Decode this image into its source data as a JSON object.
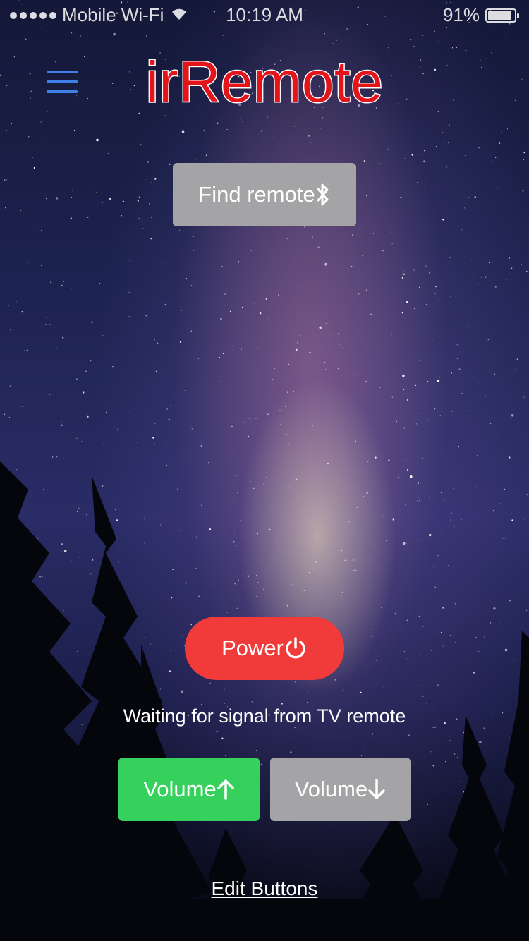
{
  "status_bar": {
    "carrier": "Mobile Wi-Fi",
    "time": "10:19 AM",
    "battery_text": "91%",
    "battery_level": 0.91
  },
  "header": {
    "menu_icon": "hamburger-menu-icon",
    "title": "irRemote",
    "title_color": "#e4141b",
    "menu_color": "#3f7fe8"
  },
  "find_remote": {
    "label": "Find remote",
    "icon": "bluetooth-icon",
    "color": "#a4a4a6"
  },
  "power": {
    "label": "Power",
    "icon": "power-icon",
    "color": "#f13a3a"
  },
  "status_message": "Waiting for signal from TV remote",
  "volume_up": {
    "label": "Volume",
    "icon": "arrow-up-icon",
    "color": "#35d15c"
  },
  "volume_down": {
    "label": "Volume",
    "icon": "arrow-down-icon",
    "color": "#a4a4a6"
  },
  "edit_buttons": {
    "label": "Edit Buttons"
  }
}
